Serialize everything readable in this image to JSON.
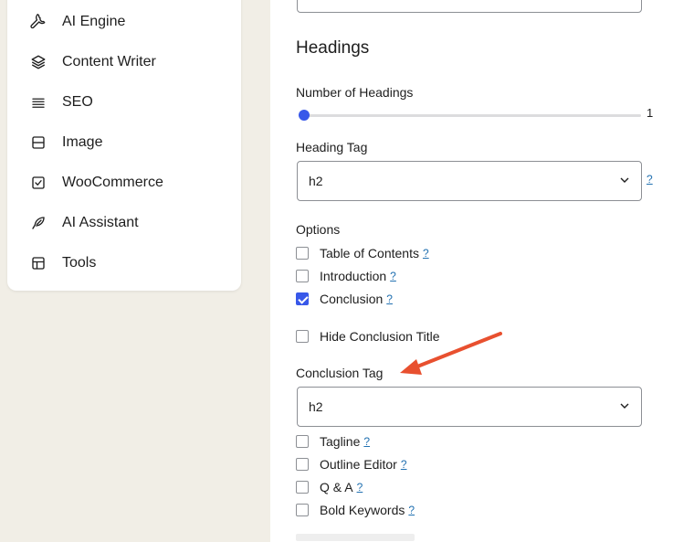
{
  "sidebar": {
    "items": [
      {
        "label": "AI Engine",
        "icon": "wrench-icon"
      },
      {
        "label": "Content Writer",
        "icon": "layers-icon"
      },
      {
        "label": "SEO",
        "icon": "lines-icon"
      },
      {
        "label": "Image",
        "icon": "image-icon"
      },
      {
        "label": "WooCommerce",
        "icon": "checkbox-icon"
      },
      {
        "label": "AI Assistant",
        "icon": "feather-icon"
      },
      {
        "label": "Tools",
        "icon": "layout-icon"
      }
    ]
  },
  "headings": {
    "title": "Headings",
    "number_label": "Number of Headings",
    "number_value": "1",
    "heading_tag_label": "Heading Tag",
    "heading_tag_value": "h2",
    "help": "?"
  },
  "options": {
    "label": "Options",
    "items": [
      {
        "label": "Table of Contents",
        "help": "?",
        "checked": false
      },
      {
        "label": "Introduction",
        "help": "?",
        "checked": false
      },
      {
        "label": "Conclusion",
        "help": "?",
        "checked": true
      },
      {
        "label": "Hide Conclusion Title",
        "help": "",
        "checked": false
      }
    ]
  },
  "conclusion": {
    "tag_label": "Conclusion Tag",
    "tag_value": "h2"
  },
  "extra_options": [
    {
      "label": "Tagline",
      "help": "?",
      "checked": false
    },
    {
      "label": "Outline Editor",
      "help": "?",
      "checked": false
    },
    {
      "label": "Q & A",
      "help": "?",
      "checked": false
    },
    {
      "label": "Bold Keywords",
      "help": "?",
      "checked": false
    }
  ],
  "colors": {
    "accent": "#3858e9",
    "link": "#2271b1",
    "arrow": "#e8502f",
    "background": "#f1eee6"
  }
}
